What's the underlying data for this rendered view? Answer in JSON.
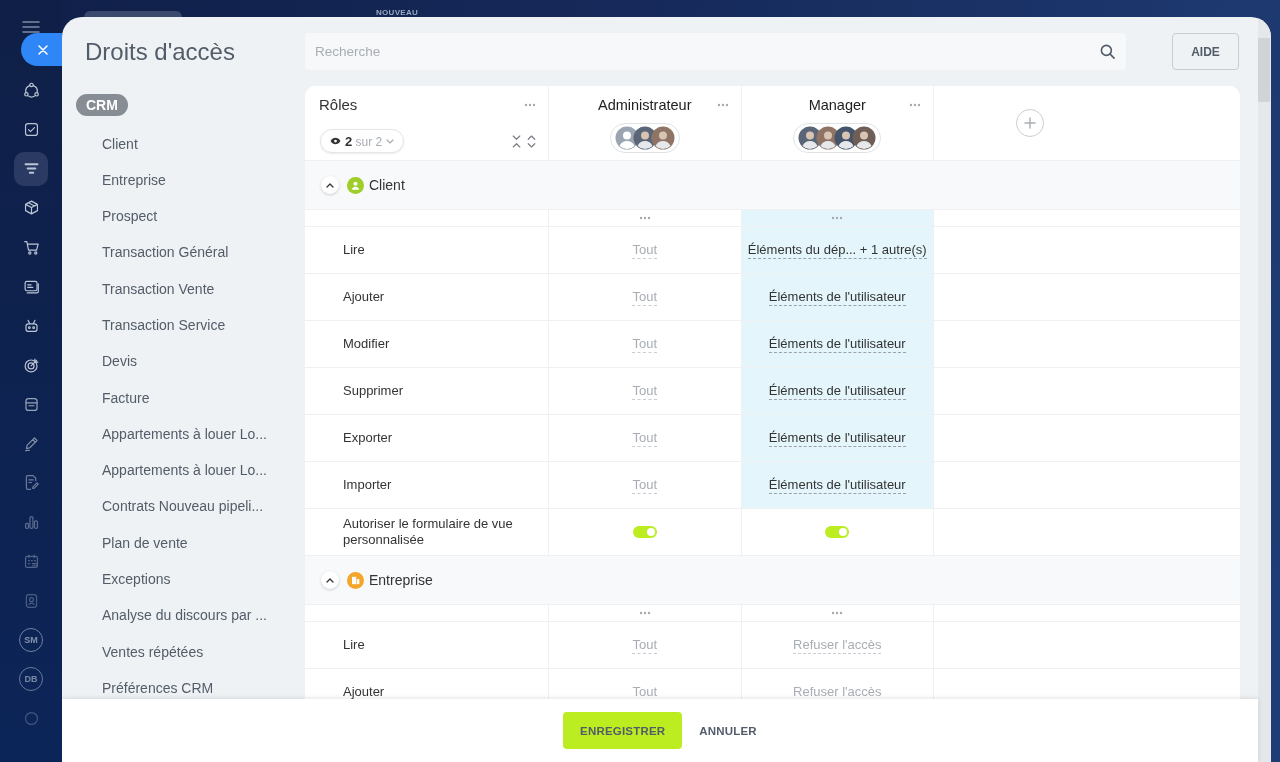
{
  "background": {
    "label": "NOUVEAU"
  },
  "rail": {
    "items": [
      {
        "kind": "icon",
        "selected": false
      },
      {
        "kind": "icon",
        "selected": false
      },
      {
        "kind": "icon",
        "selected": true
      },
      {
        "kind": "icon",
        "selected": false
      },
      {
        "kind": "icon",
        "selected": false
      },
      {
        "kind": "icon",
        "selected": false
      },
      {
        "kind": "icon",
        "selected": false
      },
      {
        "kind": "icon",
        "selected": false
      },
      {
        "kind": "icon",
        "selected": false
      },
      {
        "kind": "icon",
        "selected": false
      },
      {
        "kind": "icon",
        "selected": false
      },
      {
        "kind": "icon",
        "selected": false
      },
      {
        "kind": "icon",
        "selected": false
      },
      {
        "kind": "icon",
        "selected": false
      },
      {
        "kind": "initials",
        "label": "SM",
        "selected": false
      },
      {
        "kind": "initials",
        "label": "DB",
        "selected": false
      },
      {
        "kind": "icon",
        "selected": false
      }
    ]
  },
  "title": "Droits d'accès",
  "search": {
    "placeholder": "Recherche"
  },
  "help_button": "AIDE",
  "sidebar": {
    "group": "CRM",
    "items": [
      "Client",
      "Entreprise",
      "Prospect",
      "Transaction Général",
      "Transaction Vente",
      "Transaction Service",
      "Devis",
      "Facture",
      "Appartements à louer Lo...",
      "Appartements à louer Lo...",
      "Contrats Nouveau pipeli...",
      "Plan de vente",
      "Exceptions",
      "Analyse du discours par ...",
      "Ventes répétées",
      "Préférences CRM"
    ]
  },
  "roles_header": {
    "label": "Rôles",
    "filter": "**2** sur 2"
  },
  "roles": [
    {
      "name": "Administrateur",
      "avatars": [
        {
          "kind": "default"
        },
        {
          "kind": "photo"
        },
        {
          "kind": "photo"
        }
      ]
    },
    {
      "name": "Manager",
      "avatars": [
        {
          "kind": "photo"
        },
        {
          "kind": "photo"
        },
        {
          "kind": "photo"
        },
        {
          "kind": "photo"
        }
      ]
    }
  ],
  "sections": [
    {
      "title": "Client",
      "kind": "contact",
      "color": "#9fcd2a",
      "expanded": true,
      "menu_cells": [
        {
          "highlighted": false
        },
        {
          "highlighted": true
        }
      ],
      "rows": [
        {
          "kind": "select",
          "label": "Lire",
          "cells": [
            {
              "value": "Tout",
              "highlighted": false
            },
            {
              "value": "Éléments du dép... + 1 autre(s)",
              "highlighted": true
            }
          ]
        },
        {
          "kind": "select",
          "label": "Ajouter",
          "cells": [
            {
              "value": "Tout",
              "highlighted": false
            },
            {
              "value": "Éléments de l'utilisateur",
              "highlighted": true
            }
          ]
        },
        {
          "kind": "select",
          "label": "Modifier",
          "cells": [
            {
              "value": "Tout",
              "highlighted": false
            },
            {
              "value": "Éléments de l'utilisateur",
              "highlighted": true
            }
          ]
        },
        {
          "kind": "select",
          "label": "Supprimer",
          "cells": [
            {
              "value": "Tout",
              "highlighted": false
            },
            {
              "value": "Éléments de l'utilisateur",
              "highlighted": true
            }
          ]
        },
        {
          "kind": "select",
          "label": "Exporter",
          "cells": [
            {
              "value": "Tout",
              "highlighted": false
            },
            {
              "value": "Éléments de l'utilisateur",
              "highlighted": true
            }
          ]
        },
        {
          "kind": "select",
          "label": "Importer",
          "cells": [
            {
              "value": "Tout",
              "highlighted": false
            },
            {
              "value": "Éléments de l'utilisateur",
              "highlighted": true
            }
          ]
        },
        {
          "kind": "toggle",
          "label": "Autoriser le formulaire de vue personnalisée",
          "cells": [
            {
              "on": true,
              "highlighted": false
            },
            {
              "on": true,
              "highlighted": false
            }
          ]
        }
      ]
    },
    {
      "title": "Entreprise",
      "kind": "company",
      "color": "#f4a62a",
      "expanded": true,
      "menu_cells": [
        {
          "highlighted": false
        },
        {
          "highlighted": false
        }
      ],
      "rows": [
        {
          "kind": "select",
          "label": "Lire",
          "cells": [
            {
              "value": "Tout",
              "highlighted": false
            },
            {
              "value": "Refuser l'accès",
              "highlighted": false
            }
          ]
        },
        {
          "kind": "select",
          "label": "Ajouter",
          "cells": [
            {
              "value": "Tout",
              "highlighted": false
            },
            {
              "value": "Refuser l'accès",
              "highlighted": false
            }
          ]
        }
      ]
    }
  ],
  "footer": {
    "buttons": [
      {
        "kind": "primary",
        "label": "ENREGISTRER"
      },
      {
        "kind": "secondary",
        "label": "ANNULER"
      }
    ]
  }
}
